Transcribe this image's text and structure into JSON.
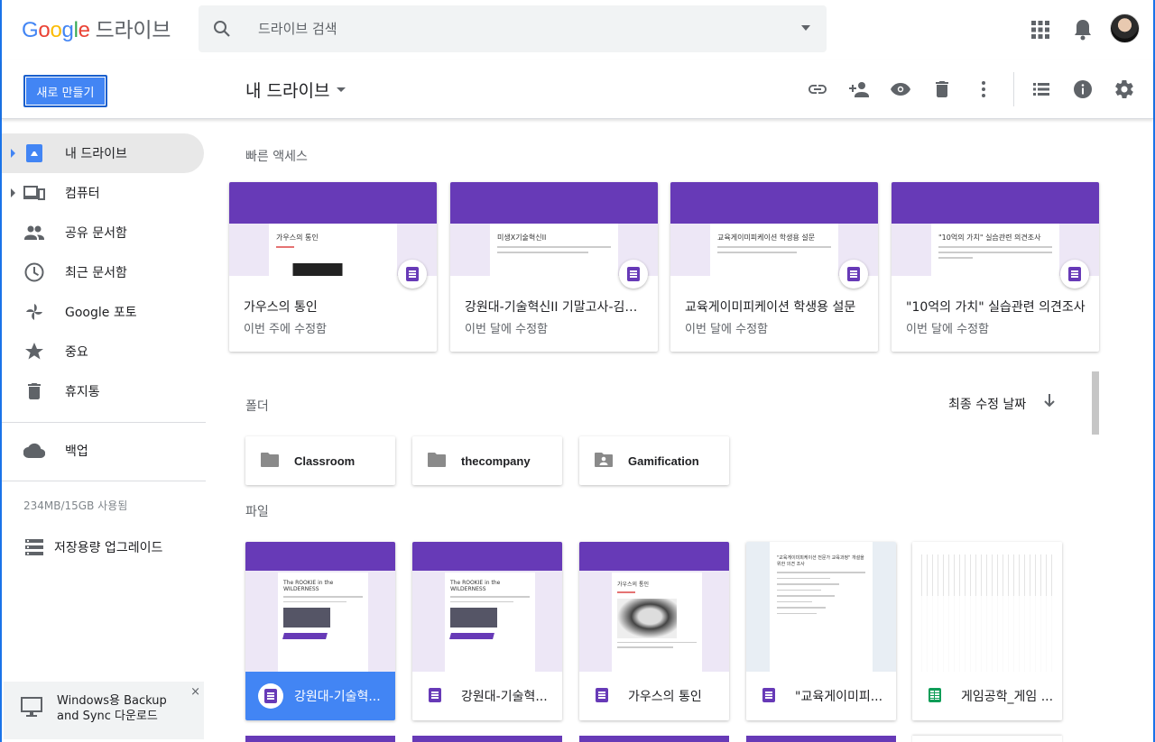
{
  "header": {
    "logo_google": "Google",
    "logo_product": "드라이브",
    "search_placeholder": "드라이브 검색"
  },
  "toolbar": {
    "new_button": "새로 만들기",
    "location_title": "내 드라이브",
    "icons": [
      "link-icon",
      "add-person-icon",
      "preview-eye-icon",
      "trash-icon",
      "more-vert-icon",
      "list-view-icon",
      "info-icon",
      "settings-gear-icon"
    ]
  },
  "sidebar": {
    "items": [
      {
        "label": "내 드라이브",
        "icon": "my-drive-icon",
        "active": true,
        "expandable": true
      },
      {
        "label": "컴퓨터",
        "icon": "computers-icon",
        "active": false,
        "expandable": true
      },
      {
        "label": "공유 문서함",
        "icon": "shared-people-icon",
        "active": false
      },
      {
        "label": "최근 문서함",
        "icon": "clock-icon",
        "active": false
      },
      {
        "label": "Google 포토",
        "icon": "photos-pinwheel-icon",
        "active": false
      },
      {
        "label": "중요",
        "icon": "star-icon",
        "active": false
      },
      {
        "label": "휴지통",
        "icon": "trash-icon",
        "active": false
      }
    ],
    "backup_label": "백업",
    "storage_text": "234MB/15GB 사용됨",
    "upgrade_label": "저장용량 업그레이드",
    "backup_promo": "Windows용 Backup and Sync 다운로드",
    "backup_close": "×"
  },
  "quick_access": {
    "title": "빠른 액세스",
    "cards": [
      {
        "title": "가우스의 통인",
        "subtitle": "이번 주에 수정함",
        "preview_title": "가우스의 통인"
      },
      {
        "title": "강원대-기술혁신II 기말고사-김상...",
        "subtitle": "이번 달에 수정함",
        "preview_title": "미생X기술혁신II"
      },
      {
        "title": "교육게이미피케이션 학생용 설문",
        "subtitle": "이번 달에 수정함",
        "preview_title": "교육게이미피케이션 학생용 설문"
      },
      {
        "title": "\"10억의 가치\" 실습관련 의견조사",
        "subtitle": "이번 달에 수정함",
        "preview_title": "\"10억의 가치\" 실습관련 의견조사"
      }
    ]
  },
  "folders": {
    "title": "폴더",
    "sort_label": "최종 수정 날짜",
    "items": [
      {
        "name": "Classroom",
        "icon": "folder-icon"
      },
      {
        "name": "thecompany",
        "icon": "folder-icon"
      },
      {
        "name": "Gamification",
        "icon": "shared-folder-icon"
      }
    ]
  },
  "files": {
    "title": "파일",
    "items": [
      {
        "name": "강원대-기술혁...",
        "type": "form",
        "selected": true,
        "preview_title": "The ROOKIE in the WILDERNESS"
      },
      {
        "name": "강원대-기술혁...",
        "type": "form",
        "selected": false,
        "preview_title": "The ROOKIE in the WILDERNESS"
      },
      {
        "name": "가우스의 통인",
        "type": "form",
        "selected": false,
        "preview_title": "가우스의 통인"
      },
      {
        "name": "\"교육게이미피...",
        "type": "form-doc",
        "selected": false,
        "preview_title": "\"교육게이미피케이션 전문가 교육과정\" 개설을 위한 의견 조사"
      },
      {
        "name": "게임공학_게임 ...",
        "type": "sheet",
        "selected": false,
        "preview_title": ""
      }
    ]
  },
  "colors": {
    "accent": "#4285f4",
    "form_purple": "#673ab7",
    "sheet_green": "#0f9d58"
  }
}
